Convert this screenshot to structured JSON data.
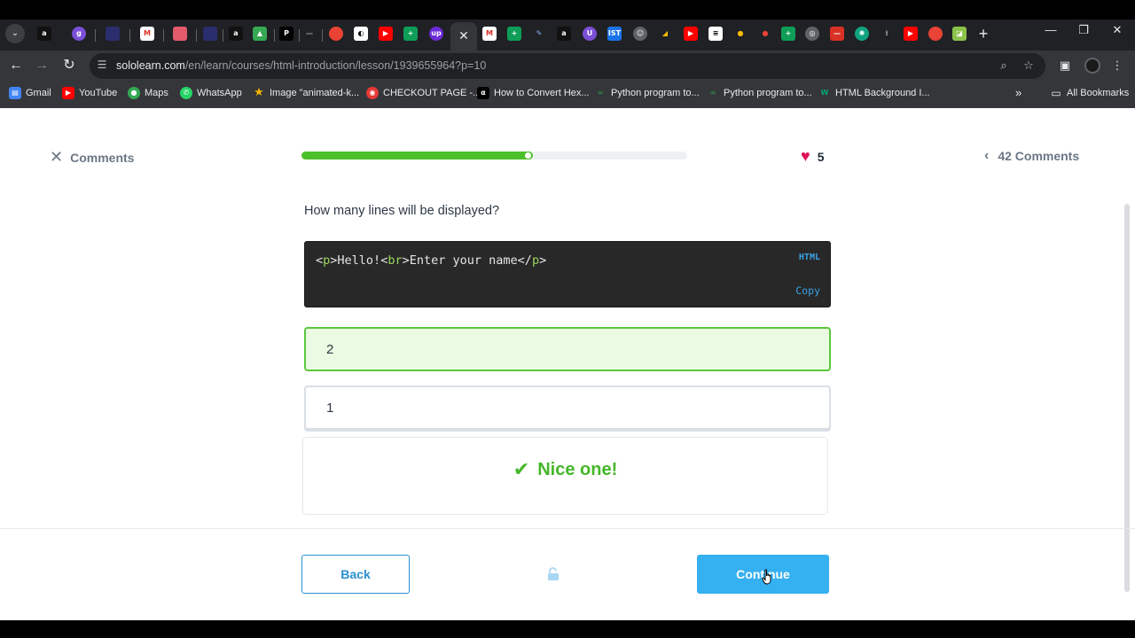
{
  "browser": {
    "active_tab_close": "✕",
    "new_tab": "+",
    "url_host": "sololearn.com",
    "url_path": "/en/learn/courses/html-introduction/lesson/1939655964?p=10",
    "bookmarks": [
      {
        "label": "Gmail",
        "color": "#4285f4"
      },
      {
        "label": "YouTube",
        "color": "#ff0000"
      },
      {
        "label": "Maps",
        "color": "#34a853"
      },
      {
        "label": "WhatsApp",
        "color": "#25d366"
      },
      {
        "label": "Image \"animated-k...",
        "color": "#f4b400"
      },
      {
        "label": "CHECKOUT PAGE -...",
        "color": "#e53935"
      },
      {
        "label": "How to Convert Hex...",
        "color": "#111111"
      },
      {
        "label": "Python program to...",
        "color": "#2f8d46"
      },
      {
        "label": "Python program to...",
        "color": "#2f8d46"
      },
      {
        "label": "HTML Background I...",
        "color": "#04aa6d"
      }
    ],
    "all_bookmarks": "All Bookmarks"
  },
  "lesson": {
    "close_comments": "Comments",
    "progress": 0.6,
    "lives": "5",
    "comments_count": "42 Comments",
    "question": "How many lines will be displayed?",
    "code": {
      "lt1": "<",
      "t1": "p",
      "gt1": ">",
      "text1": "Hello!",
      "lt2": "<",
      "t2": "br",
      "gt2": ">",
      "text2": "Enter your name",
      "lt3": "</",
      "t3": "p",
      "gt3": ">",
      "language": "HTML",
      "copy": "Copy"
    },
    "options": [
      {
        "label": "2",
        "state": "correct"
      },
      {
        "label": "1",
        "state": "default"
      }
    ],
    "feedback": "Nice one!",
    "back": "Back",
    "continue": "Continue"
  },
  "colors": {
    "accent": "#35b0f1",
    "success": "#45b72a",
    "heart": "#e0125a"
  }
}
